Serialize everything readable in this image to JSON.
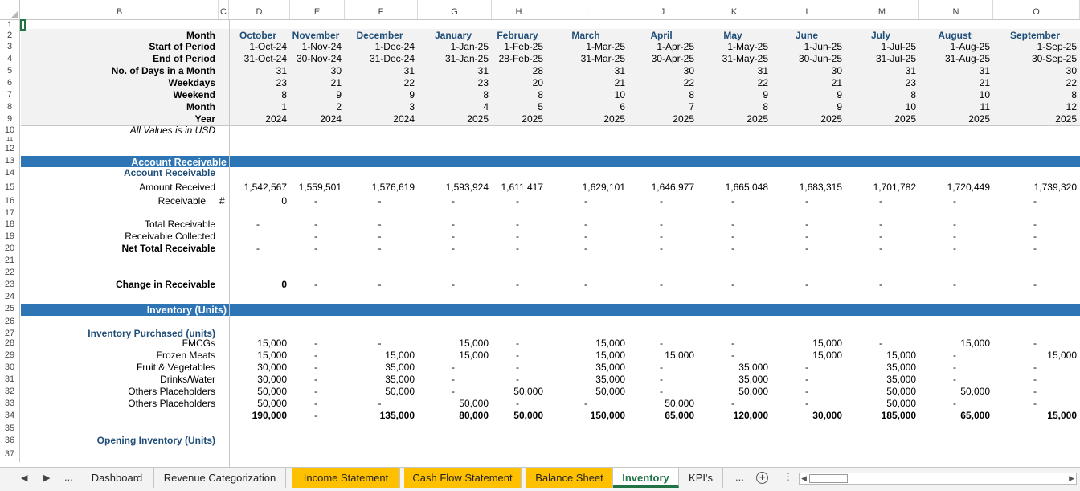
{
  "columns": [
    "B",
    "C",
    "D",
    "E",
    "F",
    "G",
    "H",
    "I",
    "J",
    "K",
    "L",
    "M",
    "N",
    "O"
  ],
  "rows": [
    "1",
    "2",
    "3",
    "4",
    "5",
    "6",
    "7",
    "8",
    "9",
    "10",
    "11",
    "12",
    "13",
    "14",
    "15",
    "16",
    "17",
    "18",
    "19",
    "20",
    "21",
    "22",
    "23",
    "24",
    "25",
    "26",
    "27",
    "28",
    "29",
    "30",
    "31",
    "32",
    "33",
    "34",
    "35",
    "36",
    "37"
  ],
  "header_labels": [
    "Month",
    "Start of Period",
    "End of Period",
    "No. of Days in a Month",
    "Weekdays",
    "Weekend",
    "Month",
    "Year"
  ],
  "header_rows": [
    [
      "October",
      "November",
      "December",
      "January",
      "February",
      "March",
      "April",
      "May",
      "June",
      "July",
      "August",
      "September"
    ],
    [
      "1-Oct-24",
      "1-Nov-24",
      "1-Dec-24",
      "1-Jan-25",
      "1-Feb-25",
      "1-Mar-25",
      "1-Apr-25",
      "1-May-25",
      "1-Jun-25",
      "1-Jul-25",
      "1-Aug-25",
      "1-Sep-25"
    ],
    [
      "31-Oct-24",
      "30-Nov-24",
      "31-Dec-24",
      "31-Jan-25",
      "28-Feb-25",
      "31-Mar-25",
      "30-Apr-25",
      "31-May-25",
      "30-Jun-25",
      "31-Jul-25",
      "31-Aug-25",
      "30-Sep-25"
    ],
    [
      "31",
      "30",
      "31",
      "31",
      "28",
      "31",
      "30",
      "31",
      "30",
      "31",
      "31",
      "30"
    ],
    [
      "23",
      "21",
      "22",
      "23",
      "20",
      "21",
      "22",
      "22",
      "21",
      "23",
      "21",
      "22"
    ],
    [
      "8",
      "9",
      "9",
      "8",
      "8",
      "10",
      "8",
      "9",
      "9",
      "8",
      "10",
      "8"
    ],
    [
      "1",
      "2",
      "3",
      "4",
      "5",
      "6",
      "7",
      "8",
      "9",
      "10",
      "11",
      "12"
    ],
    [
      "2024",
      "2024",
      "2024",
      "2025",
      "2025",
      "2025",
      "2025",
      "2025",
      "2025",
      "2025",
      "2025",
      "2025"
    ]
  ],
  "note": "All Values is in USD",
  "ar_section_title": "Account Receivable",
  "ar_subtitle": "Account Receivable",
  "ar_rows": [
    {
      "label": "Amount Received",
      "bold": false,
      "values": [
        "1,542,567",
        "1,559,501",
        "1,576,619",
        "1,593,924",
        "1,611,417",
        "1,629,101",
        "1,646,977",
        "1,665,048",
        "1,683,315",
        "1,701,782",
        "1,720,449",
        "1,739,320"
      ]
    },
    {
      "label": "Receivable",
      "bold": false,
      "extra": "#",
      "values": [
        "0",
        "-",
        "-",
        "-",
        "-",
        "-",
        "-",
        "-",
        "-",
        "-",
        "-",
        "-"
      ]
    },
    {
      "label": "Total  Receivable",
      "bold": false,
      "values": [
        "-",
        "-",
        "-",
        "-",
        "-",
        "-",
        "-",
        "-",
        "-",
        "-",
        "-",
        "-"
      ]
    },
    {
      "label": "Receivable Collected",
      "bold": false,
      "values": [
        "",
        "-",
        "-",
        "-",
        "-",
        "-",
        "-",
        "-",
        "-",
        "-",
        "-",
        "-"
      ]
    },
    {
      "label": "Net Total Receivable",
      "bold": true,
      "values": [
        "-",
        "-",
        "-",
        "-",
        "-",
        "-",
        "-",
        "-",
        "-",
        "-",
        "-",
        "-"
      ]
    },
    {
      "label": "Change in Receivable",
      "bold": true,
      "values": [
        "0",
        "-",
        "-",
        "-",
        "-",
        "-",
        "-",
        "-",
        "-",
        "-",
        "-",
        "-"
      ]
    }
  ],
  "inv_section_title": "Inventory (Units)",
  "inv_purchased_title": "Inventory Purchased (units)",
  "inv_rows": [
    {
      "label": "FMCGs",
      "values": [
        "15,000",
        "-",
        "-",
        "15,000",
        "-",
        "15,000",
        "-",
        "-",
        "15,000",
        "-",
        "15,000",
        "-"
      ]
    },
    {
      "label": "Frozen Meats",
      "values": [
        "15,000",
        "-",
        "15,000",
        "15,000",
        "-",
        "15,000",
        "15,000",
        "-",
        "15,000",
        "15,000",
        "-",
        "15,000"
      ]
    },
    {
      "label": "Fruit & Vegetables",
      "values": [
        "30,000",
        "-",
        "35,000",
        "-",
        "-",
        "35,000",
        "-",
        "35,000",
        "-",
        "35,000",
        "-",
        "-"
      ]
    },
    {
      "label": "Drinks/Water",
      "values": [
        "30,000",
        "-",
        "35,000",
        "-",
        "-",
        "35,000",
        "-",
        "35,000",
        "-",
        "35,000",
        "-",
        "-"
      ]
    },
    {
      "label": "Others Placeholders",
      "values": [
        "50,000",
        "-",
        "50,000",
        "-",
        "50,000",
        "50,000",
        "-",
        "50,000",
        "-",
        "50,000",
        "50,000",
        "-"
      ]
    },
    {
      "label": "Others Placeholders",
      "values": [
        "50,000",
        "-",
        "-",
        "50,000",
        "-",
        "-",
        "50,000",
        "-",
        "-",
        "50,000",
        "-",
        "-"
      ]
    }
  ],
  "inv_totals": [
    "190,000",
    "-",
    "135,000",
    "80,000",
    "50,000",
    "150,000",
    "65,000",
    "120,000",
    "30,000",
    "185,000",
    "65,000",
    "15,000"
  ],
  "opening_title": "Opening Inventory (Units)",
  "tabs": {
    "nav_prev": "◀",
    "nav_next": "▶",
    "ellipsis": "...",
    "items": [
      "Dashboard",
      "Revenue Categorization",
      "Income Statement",
      "Cash Flow Statement",
      "Balance Sheet",
      "Inventory",
      "KPI's"
    ],
    "ellipsis_right": "...",
    "add": "+"
  },
  "colors": {
    "section_bar": "#2e75b6",
    "tab_highlight": "#ffc000",
    "active_tab": "#217346",
    "label_blue": "#1f4e79"
  }
}
